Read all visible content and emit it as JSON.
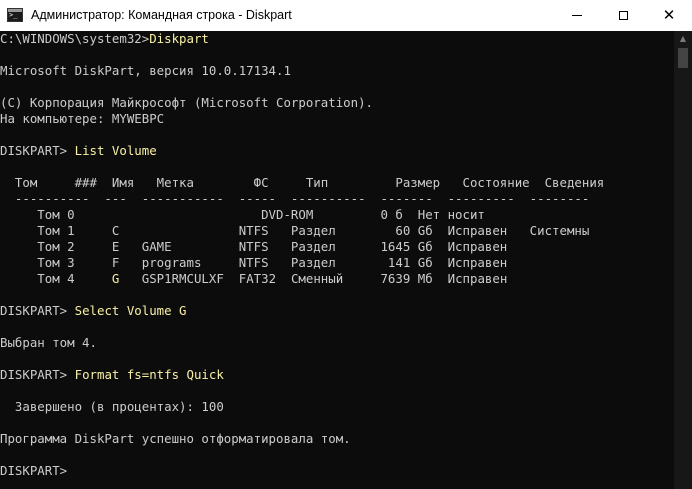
{
  "window": {
    "title": "Администратор: Командная строка - Diskpart",
    "icon": "cmd-icon",
    "controls": {
      "minimize": "minimize-icon",
      "maximize": "maximize-icon",
      "close": "close-icon",
      "close_glyph": "✕"
    }
  },
  "colors": {
    "background": "#0c0c0c",
    "text": "#cccccc",
    "command_text": "#f9f1a5",
    "titlebar": "#ffffff"
  },
  "scrollbar": {
    "up_arrow": "▲"
  },
  "console": {
    "prompt_path": "C:\\WINDOWS\\system32>",
    "command_diskpart": "Diskpart",
    "version_line": "Microsoft DiskPart, версия 10.0.17134.1",
    "copyright_line": "(C) Корпорация Майкрософт (Microsoft Corporation).",
    "computer_line": "На компьютере: MYWEBPC",
    "diskpart_prompt": "DISKPART> ",
    "command_list_volume": "List Volume",
    "volume_header": "  Том     ###  Имя   Метка        ФС     Тип         Размер   Состояние  Сведения",
    "volume_separator": "  ----------  ---  -----------  -----  ----------  -------  ---------  --------",
    "volume_rows_pre": [
      "     Том 0                         DVD-ROM         0 б  Нет носит",
      "     Том 1     C                NTFS   Раздел        60 Gб  Исправен   Системны",
      "     Том 2     E   GAME         NTFS   Раздел      1645 Gб  Исправен",
      "     Том 3     F   programs     NTFS   Раздел       141 Gб  Исправен",
      "     Том 4     "
    ],
    "volume4_letter": "G",
    "volume4_rest": "   GSP1RMCULXF  FAT32  Сменный     7639 Мб  Исправен",
    "command_select": "Select Volume G",
    "selected_msg": "Выбран том 4.",
    "command_format": "Format fs=ntfs Quick",
    "progress_msg": "  Завершено (в процентах): 100",
    "success_msg": "Программа DiskPart успешно отформатировала том.",
    "final_prompt": "DISKPART>"
  }
}
